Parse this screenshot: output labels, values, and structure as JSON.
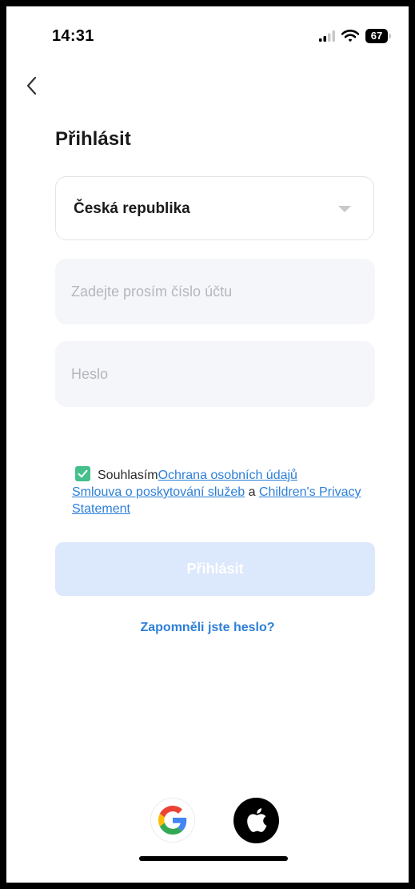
{
  "status_bar": {
    "time": "14:31",
    "battery": "67",
    "icons": [
      "signal-icon",
      "wifi-icon",
      "battery-icon"
    ]
  },
  "header": {
    "back_icon": "chevron-left-icon",
    "title": "Přihlásit"
  },
  "form": {
    "country": "Česká republika",
    "account_placeholder": "Zadejte prosím číslo účtu",
    "account_value": "",
    "password_placeholder": "Heslo",
    "password_value": "",
    "agreement": {
      "checked": true,
      "prefix": "Souhlasím",
      "privacy_link": "Ochrana osobních údajů",
      "service_link": "Smlouva o poskytování služeb",
      "conjunction": " a ",
      "children_link": "Children's Privacy Statement"
    },
    "login_label": "Přihlásit",
    "forgot_password": "Zapomněli jste heslo?"
  },
  "social_login": {
    "icons": [
      "google-icon",
      "apple-icon"
    ]
  },
  "colors": {
    "accent": "#2d7fd8",
    "checkbox": "#45c08d",
    "login_disabled": "#dce8fb",
    "field_background": "#f5f6fa"
  }
}
